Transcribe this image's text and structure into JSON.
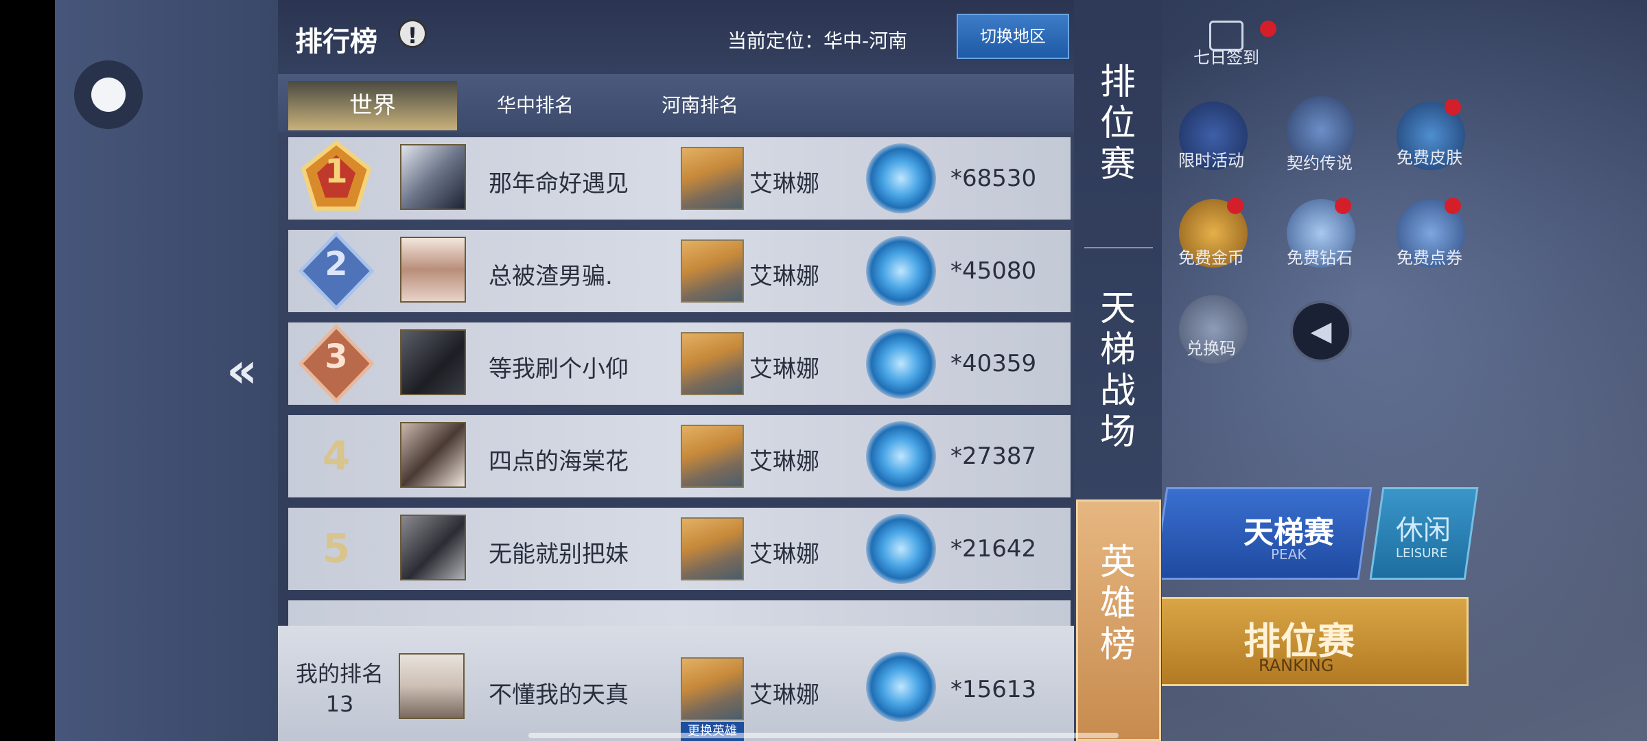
{
  "header": {
    "title": "排行榜",
    "location": "当前定位：华中-河南",
    "switch_label": "切换地区"
  },
  "tabs": [
    "世界",
    "华中排名",
    "河南排名"
  ],
  "rankings": [
    {
      "rank": "1",
      "name": "那年命好遇见",
      "hero": "艾琳娜",
      "score": "*68530"
    },
    {
      "rank": "2",
      "name": "总被渣男骗.",
      "hero": "艾琳娜",
      "score": "*45080"
    },
    {
      "rank": "3",
      "name": "等我刷个小仰",
      "hero": "艾琳娜",
      "score": "*40359"
    },
    {
      "rank": "4",
      "name": "四点的海棠花",
      "hero": "艾琳娜",
      "score": "*27387"
    },
    {
      "rank": "5",
      "name": "无能就别把妹",
      "hero": "艾琳娜",
      "score": "*21642"
    }
  ],
  "my_rank": {
    "label": "我的排名",
    "rank": "13",
    "name": "不懂我的天真",
    "hero": "艾琳娜",
    "score": "*15613",
    "change_hero": "更换英雄"
  },
  "side_tabs": {
    "ranked": "排位赛",
    "ladder": "天梯战场",
    "hero_board": "英雄榜"
  },
  "background_ui": {
    "checkin": "七日签到",
    "limited_event": "限时活动",
    "contract_legend": "契约传说",
    "free_skin": "免费皮肤",
    "free_gold": "免费金币",
    "free_diamond": "免费钻石",
    "free_voucher": "免费点券",
    "redeem_code": "兑换码",
    "peak": "天梯赛",
    "peak_en": "PEAK",
    "leisure": "休闲",
    "leisure_en": "LEISURE",
    "ranking": "排位赛",
    "ranking_en": "RANKING"
  },
  "colors": {
    "accent_gold": "#c9b27a",
    "switch_blue": "#1e5aa6",
    "notification_red": "#d41f2a"
  }
}
